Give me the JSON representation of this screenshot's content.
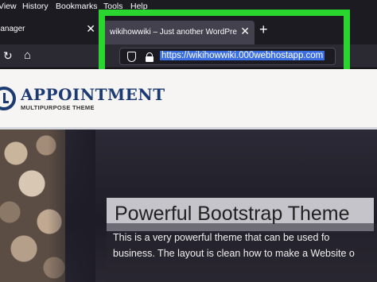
{
  "menu": {
    "view": "View",
    "history": "History",
    "bookmarks": "Bookmarks",
    "tools": "Tools",
    "help": "Help"
  },
  "tabs": {
    "inactive_label": "Manager",
    "active_label": "wikihowwiki – Just another WordPress site",
    "close_glyph": "✕",
    "new_tab_glyph": "+"
  },
  "nav": {
    "reload_glyph": "↻",
    "home_glyph": "⌂",
    "url": "https://wikihowwiki.000webhostapp.com"
  },
  "site": {
    "logo_title": "APPOINTMENT",
    "logo_subtitle": "MULTIPURPOSE THEME",
    "hero_title": "Powerful Bootstrap Theme",
    "hero_line1": "This is a very powerful theme that can be used fo",
    "hero_line2": "business. The layout is clean how to make a Website o"
  },
  "colors": {
    "highlight": "#2bd52f",
    "brand": "#1d3b73",
    "url_selection": "#3b6ee0"
  }
}
